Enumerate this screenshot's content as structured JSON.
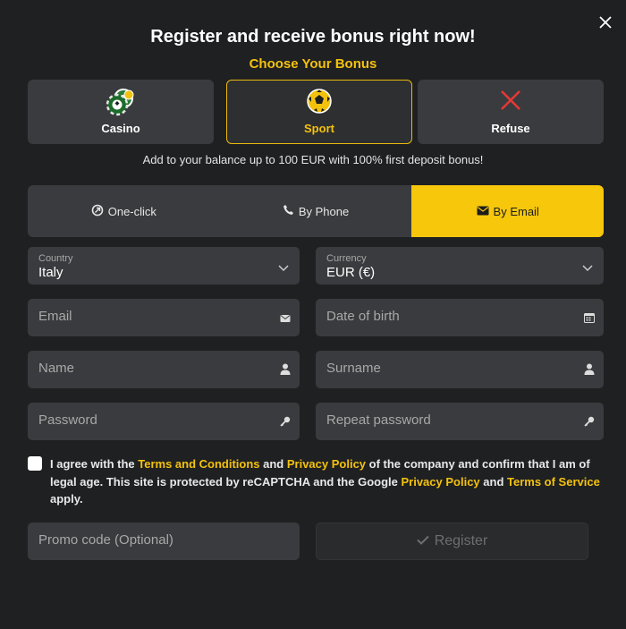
{
  "modal": {
    "title": "Register and receive bonus right now!",
    "subtitle": "Choose Your Bonus",
    "bonus_options": [
      {
        "label": "Casino",
        "icon": "casino-chips-icon",
        "selected": false
      },
      {
        "label": "Sport",
        "icon": "soccer-ball-icon",
        "selected": true
      },
      {
        "label": "Refuse",
        "icon": "red-cross-icon",
        "selected": false
      }
    ],
    "bonus_note": "Add to your balance up to 100 EUR with 100% first deposit bonus!"
  },
  "tabs": [
    {
      "label": "One-click",
      "icon": "rocket-icon",
      "active": false
    },
    {
      "label": "By Phone",
      "icon": "phone-icon",
      "active": false
    },
    {
      "label": "By Email",
      "icon": "envelope-icon",
      "active": true
    }
  ],
  "form": {
    "country": {
      "label": "Country",
      "value": "Italy"
    },
    "currency": {
      "label": "Currency",
      "value": "EUR (€)"
    },
    "email_placeholder": "Email",
    "dob_placeholder": "Date of birth",
    "name_placeholder": "Name",
    "surname_placeholder": "Surname",
    "password_placeholder": "Password",
    "repeat_password_placeholder": "Repeat password",
    "promo_placeholder": "Promo code (Optional)",
    "register_label": "Register"
  },
  "agreement": {
    "t1": "I agree with the ",
    "terms": "Terms and Conditions",
    "t2": " and ",
    "privacy1": "Privacy Policy",
    "t3": " of the company and confirm that I am of legal age. This site is protected by reCAPTCHA and the Google ",
    "privacy2": "Privacy Policy",
    "t4": " and ",
    "tos": "Terms of Service",
    "t5": " apply."
  },
  "colors": {
    "accent": "#f4c20d",
    "tab_active": "#f7c70c",
    "background": "#1f2022",
    "field": "#3a3b3e"
  }
}
